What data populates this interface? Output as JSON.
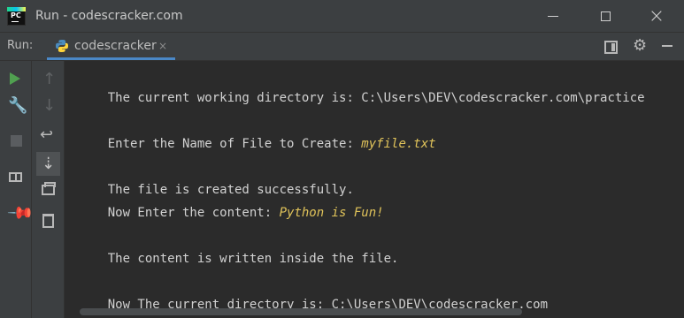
{
  "window": {
    "title": "Run - codescracker.com",
    "logo_text": "PC",
    "minimize": "–",
    "maximize": "□",
    "close": "×"
  },
  "run_toolbar": {
    "label": "Run:",
    "tab_label": "codescracker",
    "tab_close": "×"
  },
  "icons": {
    "left": [
      "play-icon",
      "wrench-icon",
      "stop-icon",
      "layout-icon",
      "pin-icon"
    ],
    "middle": [
      "up-arrow-icon",
      "down-arrow-icon",
      "soft-wrap-icon",
      "scroll-to-end-icon",
      "print-icon",
      "trash-icon"
    ],
    "right": [
      "layout-icon",
      "gear-icon",
      "minimize-panel-icon"
    ]
  },
  "console": {
    "lines": [
      {
        "text": "The current working directory is: C:\\Users\\DEV\\codescracker.com\\practice",
        "input": ""
      },
      {
        "text": "",
        "input": ""
      },
      {
        "text": "Enter the Name of File to Create: ",
        "input": "myfile.txt"
      },
      {
        "text": "",
        "input": ""
      },
      {
        "text": "The file is created successfully.",
        "input": ""
      },
      {
        "text": "Now Enter the content: ",
        "input": "Python is Fun!"
      },
      {
        "text": "",
        "input": ""
      },
      {
        "text": "The content is written inside the file.",
        "input": ""
      },
      {
        "text": "",
        "input": ""
      },
      {
        "text": "Now The current directory is: C:\\Users\\DEV\\codescracker.com",
        "input": ""
      }
    ]
  },
  "colors": {
    "background": "#2b2b2b",
    "panel": "#3c3f41",
    "text": "#d2d2d2",
    "input": "#e0c35a",
    "tab_underline": "#4a88c7",
    "run_green": "#50a050"
  }
}
